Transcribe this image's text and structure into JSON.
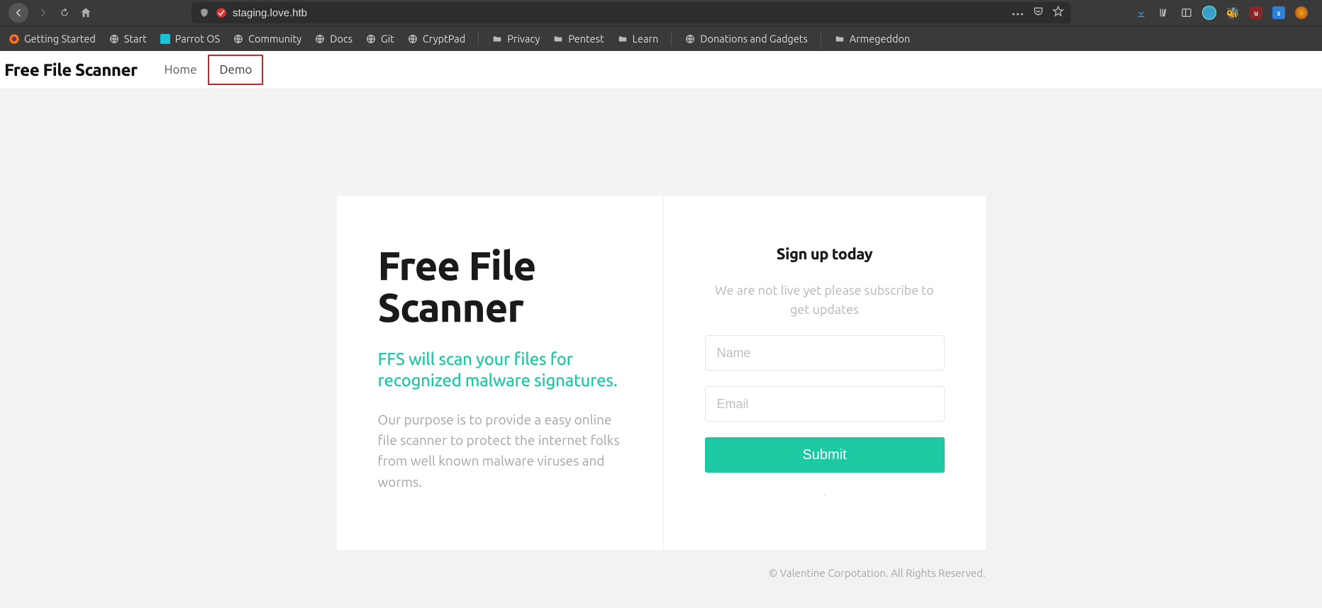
{
  "browser": {
    "url": "staging.love.htb",
    "bookmarks": [
      {
        "label": "Getting Started",
        "icon": "firefox"
      },
      {
        "label": "Start",
        "icon": "globe"
      },
      {
        "label": "Parrot OS",
        "icon": "parrot"
      },
      {
        "label": "Community",
        "icon": "globe"
      },
      {
        "label": "Docs",
        "icon": "globe"
      },
      {
        "label": "Git",
        "icon": "globe"
      },
      {
        "label": "CryptPad",
        "icon": "globe"
      },
      {
        "label": "Privacy",
        "icon": "folder"
      },
      {
        "label": "Pentest",
        "icon": "folder"
      },
      {
        "label": "Learn",
        "icon": "folder"
      },
      {
        "label": "Donations and Gadgets",
        "icon": "globe"
      },
      {
        "label": "Armegeddon",
        "icon": "folder"
      }
    ]
  },
  "site": {
    "brand": "Free File Scanner",
    "nav": {
      "home": "Home",
      "demo": "Demo"
    },
    "hero": {
      "title": "Free File Scanner",
      "subtitle": "FFS will scan your files for recognized malware signatures.",
      "body": "Our purpose is to provide a easy online file scanner to protect the internet folks from well known malware viruses and worms."
    },
    "signup": {
      "title": "Sign up today",
      "lead": "We are not live yet please subscribe to get updates",
      "name_placeholder": "Name",
      "email_placeholder": "Email",
      "submit": "Submit",
      "dot": "."
    },
    "footer": "© Valentine Corpotation. All Rights Reserved."
  }
}
